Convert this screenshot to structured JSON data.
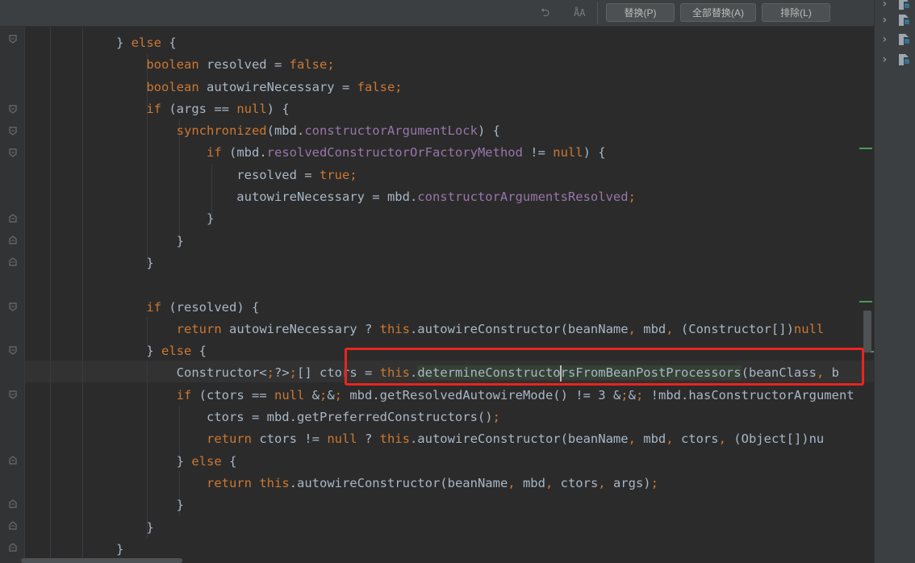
{
  "toolbar": {
    "replace_label": "替换(P)",
    "replace_all_label": "全部替换(A)",
    "exclude_label": "排除(L)",
    "undo_icon": "undo-icon",
    "case_icon": "match-case-icon"
  },
  "code_lines": [
    "} else {",
    "    boolean resolved = false;",
    "    boolean autowireNecessary = false;",
    "    if (args == null) {",
    "        synchronized(mbd.constructorArgumentLock) {",
    "            if (mbd.resolvedConstructorOrFactoryMethod != null) {",
    "                resolved = true;",
    "                autowireNecessary = mbd.constructorArgumentsResolved;",
    "            }",
    "        }",
    "    }",
    "",
    "    if (resolved) {",
    "        return autowireNecessary ? this.autowireConstructor(beanName, mbd, (Constructor[])null",
    "    } else {",
    "        Constructor<?>[] ctors = this.determineConstructorsFromBeanPostProcessors(beanClass, b",
    "        if (ctors == null && mbd.getResolvedAutowireMode() != 3 && !mbd.hasConstructorArgument",
    "            ctors = mbd.getPreferredConstructors();",
    "            return ctors != null ? this.autowireConstructor(beanName, mbd, ctors, (Object[])nu",
    "        } else {",
    "            return this.autowireConstructor(beanName, mbd, ctors, args);",
    "        }",
    "    }",
    "}"
  ],
  "highlight": {
    "term": "determineConstructorsFromBeanPostProcessors",
    "box_color": "#e8251f"
  },
  "colors": {
    "background": "#2b2b2b",
    "keyword": "#cc7832",
    "field": "#9876aa",
    "number": "#6897bb",
    "plain": "#a9b7c6"
  },
  "right_panel": {
    "items": [
      {
        "chevron": "chevron-right-icon",
        "file": "java-class-file-icon"
      },
      {
        "chevron": "chevron-right-icon",
        "file": "java-class-file-icon"
      },
      {
        "chevron": "chevron-right-icon",
        "file": "java-class-file-icon"
      },
      {
        "chevron": "chevron-right-icon",
        "file": "java-class-file-icon"
      }
    ]
  }
}
